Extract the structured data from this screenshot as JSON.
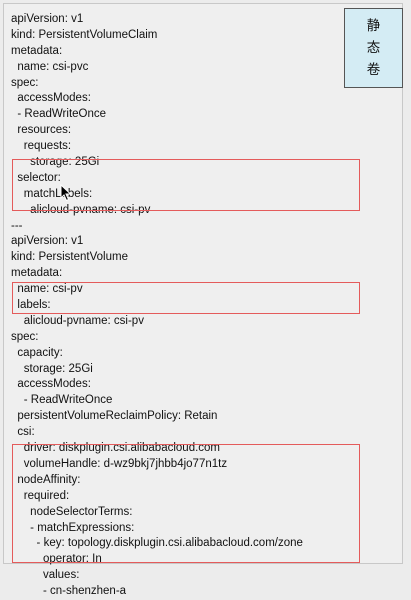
{
  "static_tag": {
    "chars": [
      "静",
      "态",
      "卷"
    ]
  },
  "yaml_lines": [
    "apiVersion: v1",
    "kind: PersistentVolumeClaim",
    "metadata:",
    "  name: csi-pvc",
    "spec:",
    "  accessModes:",
    "  - ReadWriteOnce",
    "  resources:",
    "    requests:",
    "      storage: 25Gi",
    "  selector:",
    "    matchLabels:",
    "      alicloud-pvname: csi-pv",
    "---",
    "apiVersion: v1",
    "kind: PersistentVolume",
    "metadata:",
    "  name: csi-pv",
    "  labels:",
    "    alicloud-pvname: csi-pv",
    "spec:",
    "  capacity:",
    "    storage: 25Gi",
    "  accessModes:",
    "    - ReadWriteOnce",
    "  persistentVolumeReclaimPolicy: Retain",
    "  csi:",
    "    driver: diskplugin.csi.alibabacloud.com",
    "    volumeHandle: d-wz9bkj7jhbb4jo77n1tz",
    "  nodeAffinity:",
    "    required:",
    "      nodeSelectorTerms:",
    "      - matchExpressions:",
    "        - key: topology.diskplugin.csi.alibabacloud.com/zone",
    "          operator: In",
    "          values:",
    "          - cn-shenzhen-a"
  ],
  "highlight_color": "#e45b5b",
  "tag_background": "#d4ecf4"
}
